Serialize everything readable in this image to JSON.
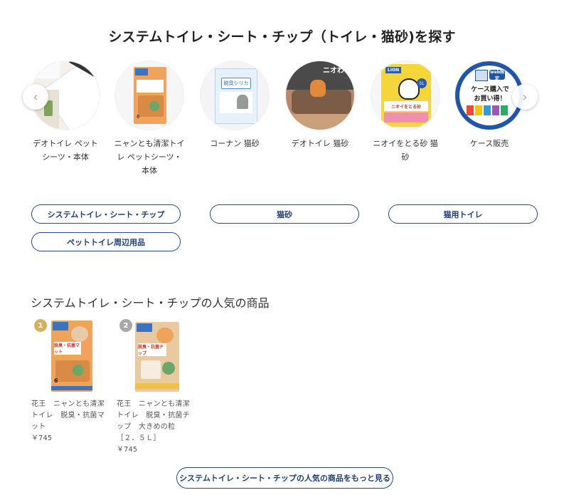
{
  "page": {
    "title": "システムトイレ・シート・チップ（トイレ・猫砂)を探す"
  },
  "carousel": {
    "prev_icon": "chevron-left-icon",
    "next_icon": "chevron-right-icon",
    "items": [
      {
        "label": "デオトイレ ペットシーツ・本体"
      },
      {
        "label": "ニャンとも清潔トイレ ペットシーツ・本体"
      },
      {
        "label": "コーナン 猫砂",
        "pack_text": "脱臭シリカ"
      },
      {
        "label": "デオトイレ 猫砂",
        "pack_text": "ニオわ"
      },
      {
        "label": "ニオイをとる砂 猫砂",
        "brand": "LION",
        "pack_text": "ニオイをとる砂",
        "size": "5L"
      },
      {
        "label": "ケース販売",
        "badge": "web限定",
        "line1": "ケース購入で",
        "line2": "お買い得！"
      }
    ]
  },
  "categories": {
    "buttons": [
      {
        "label": "システムトイレ・シート・チップ"
      },
      {
        "label": "猫砂"
      },
      {
        "label": "猫用トイレ"
      },
      {
        "label": "ペットトイレ周辺用品"
      }
    ]
  },
  "popular": {
    "title": "システムトイレ・シート・チップの人気の商品",
    "products": [
      {
        "rank": "1",
        "name": "花王　ニャンとも清潔トイレ　脱臭・抗菌マット",
        "price": "￥745",
        "pack_text": "脱臭・抗菌マット",
        "count": "6",
        "rank_color": "#d4b25a"
      },
      {
        "rank": "2",
        "name": "花王　ニャンとも清潔トイレ　脱臭・抗菌チップ　大きめの粒　［２．５Ｌ］",
        "price": "￥745",
        "pack_text": "脱臭・抗菌チップ",
        "rank_color": "#a8a8a8"
      }
    ],
    "more_label": "システムトイレ・シート・チップの人気の商品をもっと見る"
  }
}
